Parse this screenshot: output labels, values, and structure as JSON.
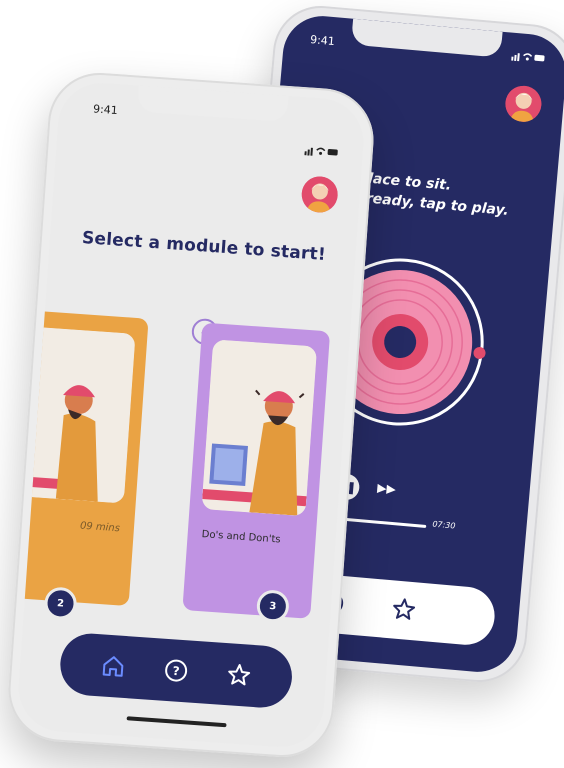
{
  "back_screen": {
    "status_time": "9:41",
    "status_icons": "signal-wifi-battery",
    "instruction_line1": "quiet place to sit.",
    "instruction_line2": "you’re ready, tap to play.",
    "time_elapsed": "07:30",
    "progress_fraction": 1.0,
    "nav": {
      "items": [
        {
          "icon": "help-icon"
        },
        {
          "icon": "star-icon"
        }
      ]
    }
  },
  "front_screen": {
    "status_time": "9:41",
    "status_icons": "signal-wifi-battery",
    "title": "Select a module to start!",
    "modules": [
      {
        "number": "2",
        "duration": "09 mins",
        "color": "#eaa344"
      },
      {
        "number": "3",
        "label": "Do's and Don'ts",
        "color": "#c093e3",
        "selected": true
      }
    ],
    "nav": {
      "items": [
        {
          "icon": "home-icon",
          "active": true
        },
        {
          "icon": "help-icon"
        },
        {
          "icon": "star-icon"
        }
      ]
    }
  },
  "colors": {
    "navy": "#252a63",
    "pink": "#e24b6c",
    "orange": "#eaa344",
    "purple": "#c093e3"
  }
}
